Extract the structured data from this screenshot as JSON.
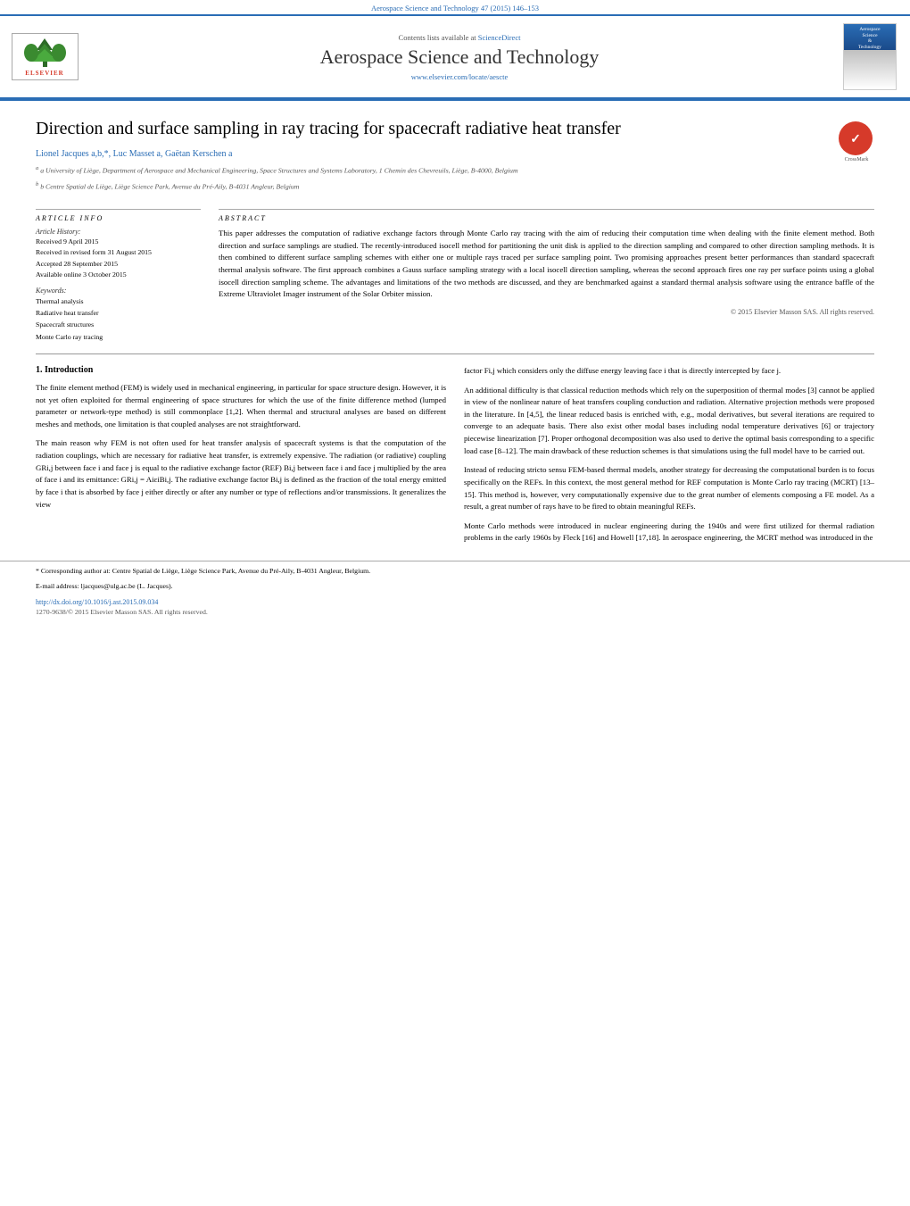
{
  "page": {
    "journal_bar_text": "Aerospace Science and Technology 47 (2015) 146–153",
    "content_line": "Contents lists available at",
    "sciencedirect_link": "ScienceDirect",
    "journal_title": "Aerospace Science and Technology",
    "journal_url": "www.elsevier.com/locate/aescte",
    "elsevier_label": "ELSEVIER"
  },
  "article": {
    "title": "Direction and surface sampling in ray tracing for spacecraft radiative heat transfer",
    "authors": "Lionel Jacques a,b,*, Luc Masset a, Gaëtan Kerschen a",
    "affiliations": [
      "a University of Liège, Department of Aerospace and Mechanical Engineering, Space Structures and Systems Laboratory, 1 Chemin des Chevreuils, Liège, B-4000, Belgium",
      "b Centre Spatial de Liège, Liège Science Park, Avenue du Pré-Aily, B-4031 Angleur, Belgium"
    ]
  },
  "article_info": {
    "section_label": "ARTICLE  INFO",
    "history_label": "Article History:",
    "received": "Received 9 April 2015",
    "revised": "Received in revised form 31 August 2015",
    "accepted": "Accepted 28 September 2015",
    "available": "Available online 3 October 2015",
    "keywords_label": "Keywords:",
    "keywords": [
      "Thermal analysis",
      "Radiative heat transfer",
      "Spacecraft structures",
      "Monte Carlo ray tracing"
    ]
  },
  "abstract": {
    "section_label": "ABSTRACT",
    "text": "This paper addresses the computation of radiative exchange factors through Monte Carlo ray tracing with the aim of reducing their computation time when dealing with the finite element method. Both direction and surface samplings are studied. The recently-introduced isocell method for partitioning the unit disk is applied to the direction sampling and compared to other direction sampling methods. It is then combined to different surface sampling schemes with either one or multiple rays traced per surface sampling point. Two promising approaches present better performances than standard spacecraft thermal analysis software. The first approach combines a Gauss surface sampling strategy with a local isocell direction sampling, whereas the second approach fires one ray per surface points using a global isocell direction sampling scheme. The advantages and limitations of the two methods are discussed, and they are benchmarked against a standard thermal analysis software using the entrance baffle of the Extreme Ultraviolet Imager instrument of the Solar Orbiter mission.",
    "copyright": "© 2015 Elsevier Masson SAS. All rights reserved."
  },
  "body": {
    "section1_heading": "1. Introduction",
    "col1_paragraphs": [
      "The finite element method (FEM) is widely used in mechanical engineering, in particular for space structure design. However, it is not yet often exploited for thermal engineering of space structures for which the use of the finite difference method (lumped parameter or network-type method) is still commonplace [1,2]. When thermal and structural analyses are based on different meshes and methods, one limitation is that coupled analyses are not straightforward.",
      "The main reason why FEM is not often used for heat transfer analysis of spacecraft systems is that the computation of the radiation couplings, which are necessary for radiative heat transfer, is extremely expensive. The radiation (or radiative) coupling GRi,j between face i and face j is equal to the radiative exchange factor (REF) Bi,j between face i and face j multiplied by the area of face i and its emittance: GRi,j = AiεiBi,j. The radiative exchange factor Bi,j is defined as the fraction of the total energy emitted by face i that is absorbed by face j either directly or after any number or type of reflections and/or transmissions. It generalizes the view"
    ],
    "col2_paragraphs": [
      "factor Fi,j which considers only the diffuse energy leaving face i that is directly intercepted by face j.",
      "An additional difficulty is that classical reduction methods which rely on the superposition of thermal modes [3] cannot be applied in view of the nonlinear nature of heat transfers coupling conduction and radiation. Alternative projection methods were proposed in the literature. In [4,5], the linear reduced basis is enriched with, e.g., modal derivatives, but several iterations are required to converge to an adequate basis. There also exist other modal bases including nodal temperature derivatives [6] or trajectory piecewise linearization [7]. Proper orthogonal decomposition was also used to derive the optimal basis corresponding to a specific load case [8–12]. The main drawback of these reduction schemes is that simulations using the full model have to be carried out.",
      "Instead of reducing stricto sensu FEM-based thermal models, another strategy for decreasing the computational burden is to focus specifically on the REFs. In this context, the most general method for REF computation is Monte Carlo ray tracing (MCRT) [13–15]. This method is, however, very computationally expensive due to the great number of elements composing a FE model. As a result, a great number of rays have to be fired to obtain meaningful REFs.",
      "Monte Carlo methods were introduced in nuclear engineering during the 1940s and were first utilized for thermal radiation problems in the early 1960s by Fleck [16] and Howell [17,18]. In aerospace engineering, the MCRT method was introduced in the"
    ]
  },
  "footnotes": {
    "corresponding_author": "* Corresponding author at: Centre Spatial de Liège, Liège Science Park, Avenue du Pré-Aily, B-4031 Angleur, Belgium.",
    "email": "E-mail address: ljacques@ulg.ac.be (L. Jacques).",
    "doi": "http://dx.doi.org/10.1016/j.ast.2015.09.034",
    "issn": "1270-9638/© 2015 Elsevier Masson SAS. All rights reserved."
  }
}
